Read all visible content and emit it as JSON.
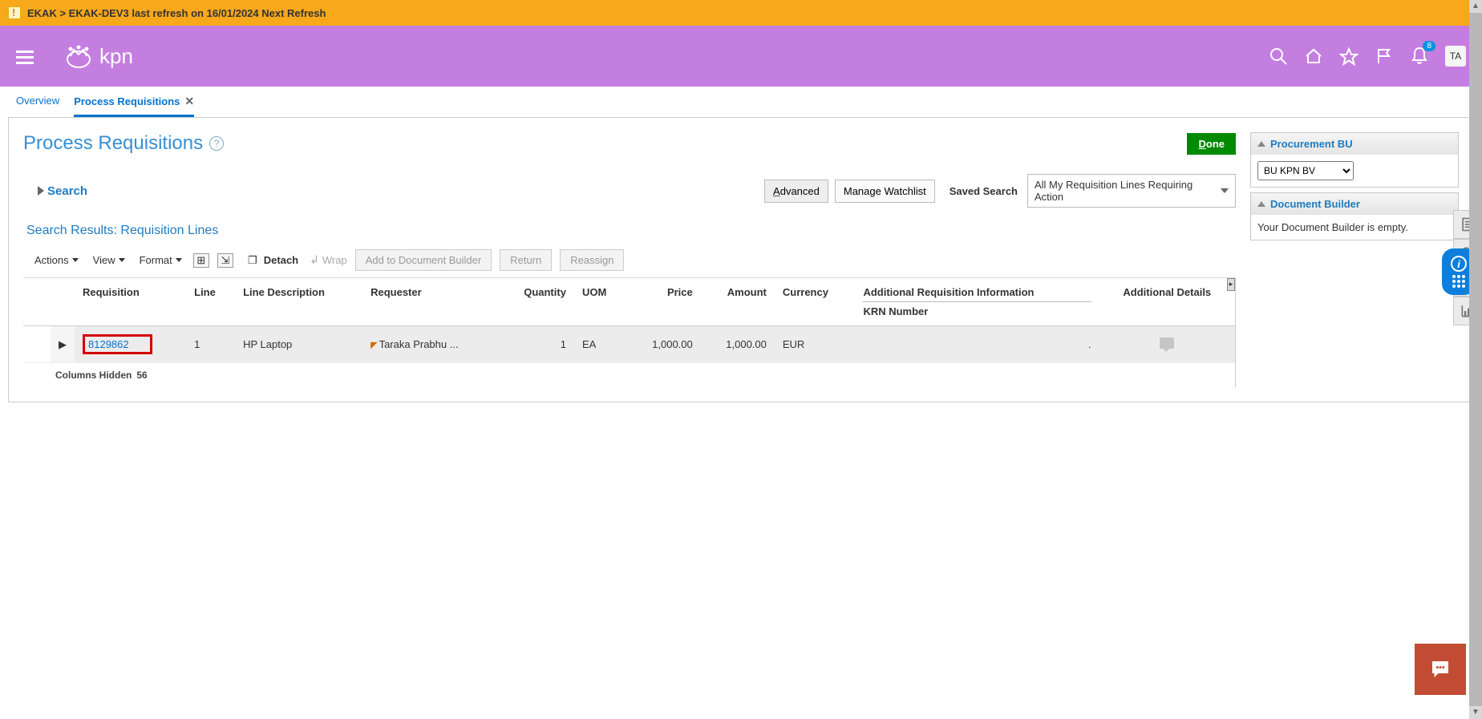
{
  "banner": {
    "text": "EKAK > EKAK-DEV3 last refresh on 16/01/2024 Next Refresh"
  },
  "header": {
    "logo_text": "kpn",
    "notif_count": "8",
    "avatar": "TA"
  },
  "tabs": {
    "overview": "Overview",
    "process_req": "Process Requisitions"
  },
  "page": {
    "title": "Process Requisitions",
    "done": "Done"
  },
  "search": {
    "label": "Search",
    "advanced": "Advanced",
    "manage_watchlist": "Manage Watchlist",
    "saved_search_label": "Saved Search",
    "saved_search_value": "All My Requisition Lines Requiring Action"
  },
  "results": {
    "title": "Search Results: Requisition Lines"
  },
  "toolbar": {
    "actions": "Actions",
    "view": "View",
    "format": "Format",
    "detach": "Detach",
    "wrap": "Wrap",
    "add_doc": "Add to Document Builder",
    "return": "Return",
    "reassign": "Reassign"
  },
  "table": {
    "headers": {
      "requisition": "Requisition",
      "line": "Line",
      "line_desc": "Line Description",
      "requester": "Requester",
      "quantity": "Quantity",
      "uom": "UOM",
      "price": "Price",
      "amount": "Amount",
      "currency": "Currency",
      "addl_info": "Additional Requisition Information",
      "krn": "KRN Number",
      "addl_details": "Additional Details"
    },
    "row": {
      "requisition": "8129862",
      "line": "1",
      "line_desc": "HP Laptop",
      "requester": "Taraka Prabhu ...",
      "quantity": "1",
      "uom": "EA",
      "price": "1,000.00",
      "amount": "1,000.00",
      "currency": "EUR",
      "addl_info": "."
    },
    "footer_label": "Columns Hidden",
    "footer_count": "56"
  },
  "side": {
    "procurement_title": "Procurement BU",
    "procurement_value": "BU KPN BV",
    "doc_builder_title": "Document Builder",
    "doc_builder_empty": "Your Document Builder is empty."
  }
}
